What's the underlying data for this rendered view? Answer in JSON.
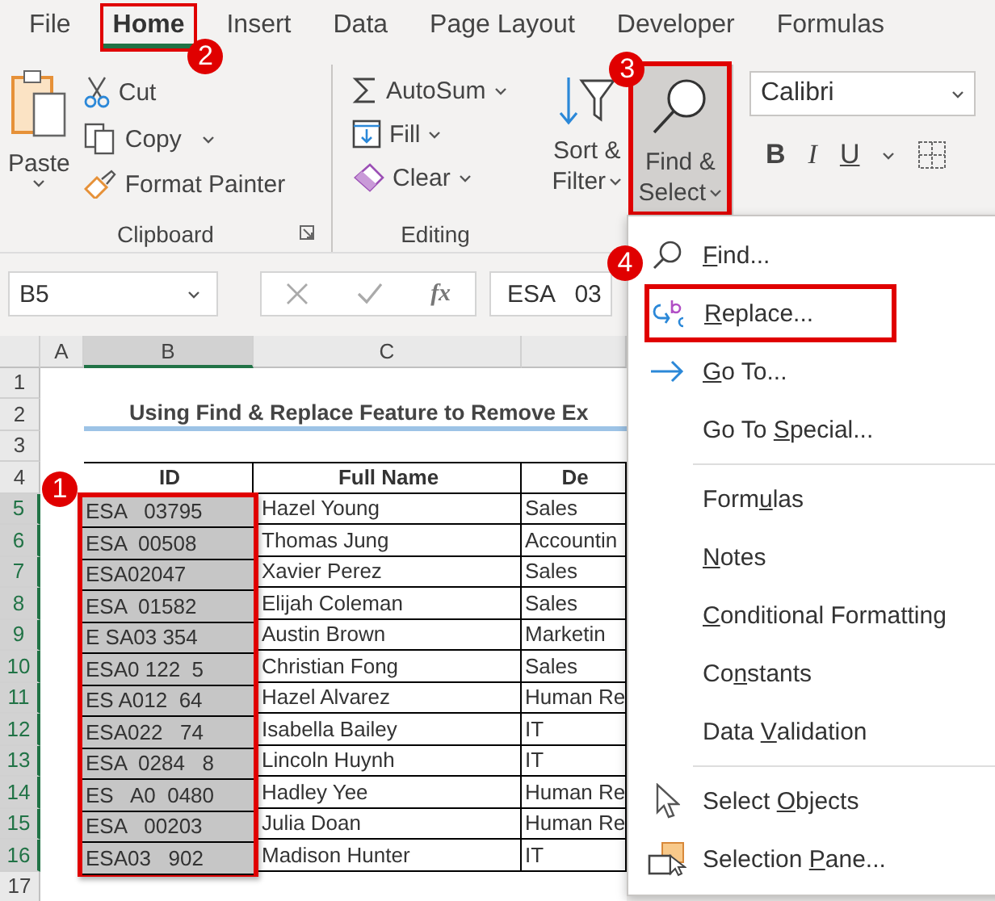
{
  "tabs": [
    {
      "label": "File",
      "selected": false,
      "highlighted": false
    },
    {
      "label": "Home",
      "selected": true,
      "highlighted": true,
      "callout": "2"
    },
    {
      "label": "Insert",
      "selected": false,
      "highlighted": false
    },
    {
      "label": "Data",
      "selected": false,
      "highlighted": false
    },
    {
      "label": "Page Layout",
      "selected": false,
      "highlighted": false
    },
    {
      "label": "Developer",
      "selected": false,
      "highlighted": false
    },
    {
      "label": "Formulas",
      "selected": false,
      "highlighted": false
    }
  ],
  "clipboard": {
    "paste": "Paste",
    "cut": "Cut",
    "copy": "Copy",
    "format_painter": "Format Painter",
    "label": "Clipboard"
  },
  "editing": {
    "autosum": "AutoSum",
    "fill": "Fill",
    "clear": "Clear",
    "sort_filter": [
      "Sort &",
      "Filter"
    ],
    "find_select": {
      "lines": [
        "Find &",
        "Select"
      ],
      "highlighted": true,
      "callout": "3"
    },
    "label": "Editing"
  },
  "font": {
    "name": "Calibri",
    "bold": "B",
    "italic": "I",
    "underline": "U"
  },
  "formula_bar": {
    "name_box": "B5",
    "fx": "fx",
    "formula": "ESA   03"
  },
  "sheet": {
    "columns": [
      {
        "label": "A",
        "selected": false
      },
      {
        "label": "B",
        "selected": true
      },
      {
        "label": "C",
        "selected": false
      }
    ],
    "row_numbers": [
      {
        "label": "1",
        "selected": false
      },
      {
        "label": "2",
        "selected": false
      },
      {
        "label": "3",
        "selected": false
      },
      {
        "label": "4",
        "selected": false
      },
      {
        "label": "5",
        "selected": true
      },
      {
        "label": "6",
        "selected": true
      },
      {
        "label": "7",
        "selected": true
      },
      {
        "label": "8",
        "selected": true
      },
      {
        "label": "9",
        "selected": true
      },
      {
        "label": "10",
        "selected": true
      },
      {
        "label": "11",
        "selected": true
      },
      {
        "label": "12",
        "selected": true
      },
      {
        "label": "13",
        "selected": true
      },
      {
        "label": "14",
        "selected": true
      },
      {
        "label": "15",
        "selected": true
      },
      {
        "label": "16",
        "selected": true
      },
      {
        "label": "17",
        "selected": false
      }
    ],
    "title": "Using Find & Replace Feature to Remove Ex",
    "table": {
      "headers": [
        "ID",
        "Full Name",
        "De"
      ],
      "highlighted": true,
      "callout": "1",
      "rows": [
        {
          "id": "ESA   03795",
          "name": "Hazel Young",
          "dept": "Sales",
          "selected": true
        },
        {
          "id": "ESA  00508",
          "name": "Thomas Jung",
          "dept": "Accountin",
          "selected": true
        },
        {
          "id": "ESA02047",
          "name": "Xavier Perez",
          "dept": "Sales",
          "selected": true
        },
        {
          "id": "ESA  01582",
          "name": "Elijah Coleman",
          "dept": "Sales",
          "selected": true
        },
        {
          "id": "E SA03 354",
          "name": "Austin Brown",
          "dept": "Marketin",
          "selected": true
        },
        {
          "id": "ESA0 122  5",
          "name": "Christian Fong",
          "dept": "Sales",
          "selected": true
        },
        {
          "id": "ES A012  64",
          "name": "Hazel Alvarez",
          "dept": "Human Re",
          "selected": true
        },
        {
          "id": "ESA022   74",
          "name": "Isabella Bailey",
          "dept": "IT",
          "selected": true
        },
        {
          "id": "ESA  0284   8",
          "name": "Lincoln Huynh",
          "dept": "IT",
          "selected": true
        },
        {
          "id": "ES   A0  0480",
          "name": "Hadley Yee",
          "dept": "Human Re",
          "selected": true
        },
        {
          "id": "ESA   00203",
          "name": "Julia Doan",
          "dept": "Human Re",
          "selected": true
        },
        {
          "id": "ESA03   902",
          "name": "Madison Hunter",
          "dept": "IT",
          "selected": true
        }
      ]
    }
  },
  "menu": {
    "sections": [
      [
        {
          "kind": "find",
          "key": "F",
          "post": "ind...",
          "highlighted": false
        },
        {
          "kind": "replace",
          "key": "R",
          "post": "eplace...",
          "highlighted": true,
          "callout": "4"
        },
        {
          "kind": "goto",
          "key": "G",
          "post": "o To...",
          "highlighted": false
        },
        {
          "kind": "plain",
          "pre": "Go To ",
          "key": "S",
          "post": "pecial...",
          "highlighted": false
        }
      ],
      [
        {
          "kind": "plain",
          "pre": "Form",
          "key": "u",
          "post": "las",
          "highlighted": false
        },
        {
          "kind": "plain",
          "key": "N",
          "post": "otes",
          "highlighted": false
        },
        {
          "kind": "plain",
          "key": "C",
          "post": "onditional Formatting",
          "highlighted": false
        },
        {
          "kind": "plain",
          "pre": "Co",
          "key": "n",
          "post": "stants",
          "highlighted": false
        },
        {
          "kind": "plain",
          "pre": "Data ",
          "key": "V",
          "post": "alidation",
          "highlighted": false
        }
      ],
      [
        {
          "kind": "select",
          "pre": "Select ",
          "key": "O",
          "post": "bjects",
          "highlighted": false
        },
        {
          "kind": "pane",
          "pre": "Selection ",
          "key": "P",
          "post": "ane...",
          "highlighted": false
        }
      ]
    ]
  }
}
